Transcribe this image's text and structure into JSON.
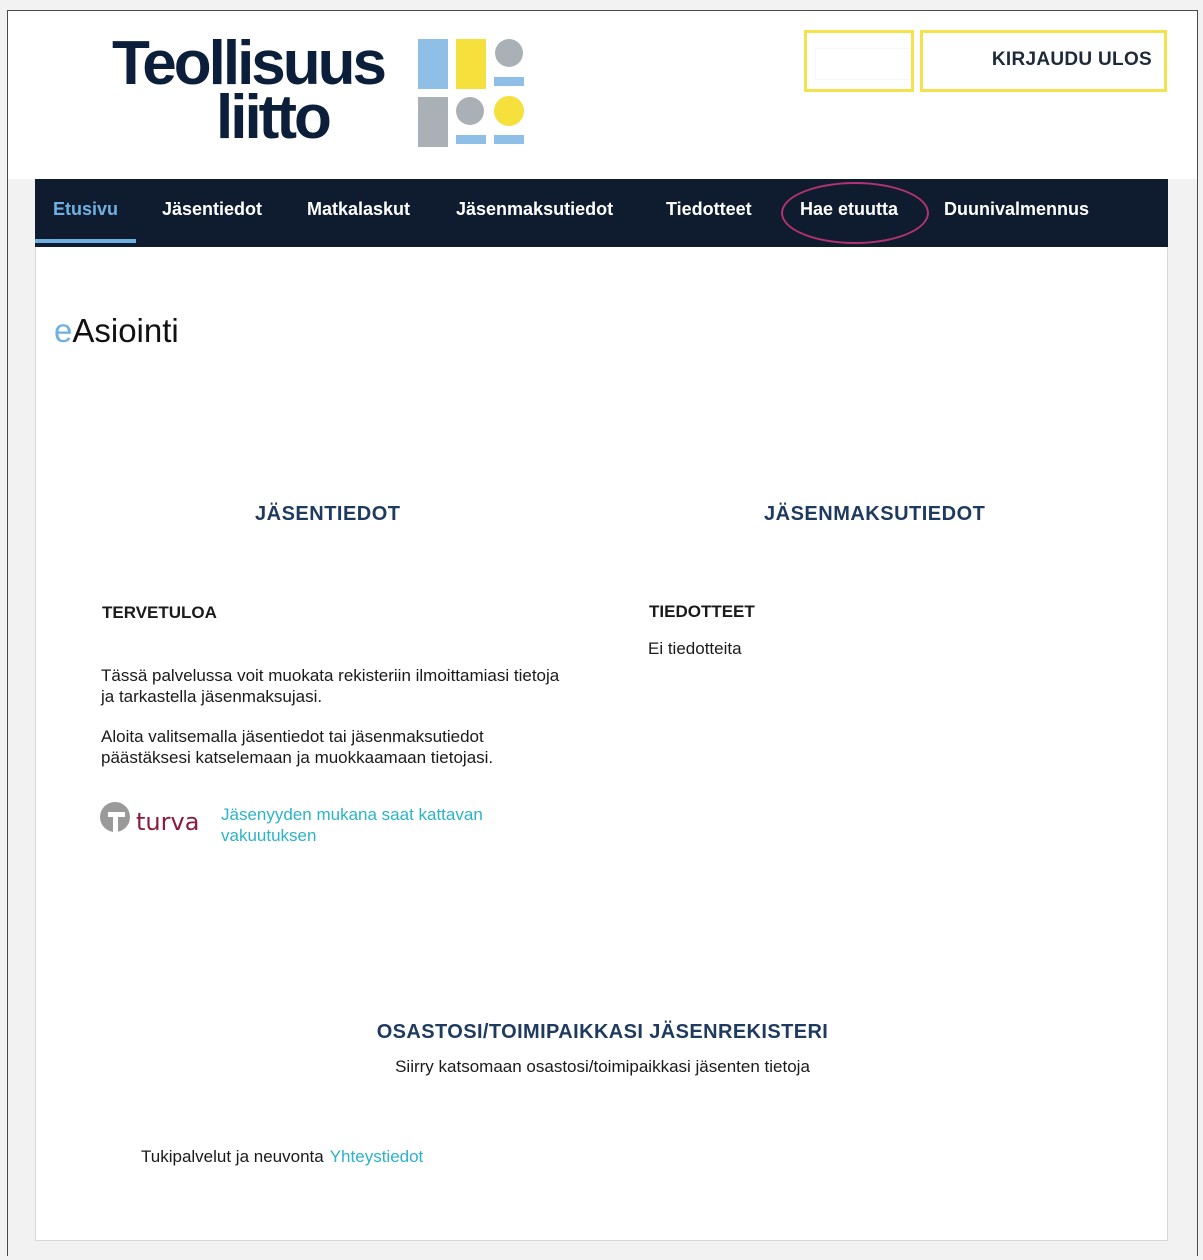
{
  "header": {
    "logo_line1": "Teollisuus",
    "logo_line2": "liitto",
    "empty_button_label": "",
    "logout_label": "KIRJAUDU ULOS"
  },
  "nav": {
    "items": [
      "Etusivu",
      "Jäsentiedot",
      "Matkalaskut",
      "Jäsenmaksutiedot",
      "Tiedotteet",
      "Hae etuutta",
      "Duunivalmennus"
    ],
    "active_index": 0,
    "highlighted_index": 5
  },
  "page": {
    "title_prefix": "e",
    "title_rest": "Asiointi"
  },
  "left": {
    "heading": "JÄSENTIEDOT",
    "welcome": "TERVETULOA",
    "para1": "Tässä palvelussa voit muokata rekisteriin ilmoittamiasi tietoja ja tarkastella jäsenmaksujasi.",
    "para2": "Aloita valitsemalla jäsentiedot tai jäsenmaksutiedot päästäksesi katselemaan ja muokkaamaan tietojasi.",
    "turva_logo_text": "turva",
    "turva_link": "Jäsenyyden mukana saat kattavan vakuutuksen"
  },
  "right": {
    "heading": "JÄSENMAKSUTIEDOT",
    "news_heading": "TIEDOTTEET",
    "news_empty": "Ei tiedotteita"
  },
  "bottom": {
    "heading": "OSASTOSI/TOIMIPAIKKASI JÄSENREKISTERI",
    "subtext": "Siirry katsomaan osastosi/toimipaikkasi jäsenten tietoja"
  },
  "footer": {
    "label": "Tukipalvelut ja neuvonta",
    "link": "Yhteystiedot"
  },
  "colors": {
    "nav_bg": "#0f1c30",
    "accent_blue": "#6fb0e0",
    "link_teal": "#2bb3c8",
    "heading_navy": "#1e3a5f",
    "button_border_yellow": "#f3e24b",
    "highlight_circle": "#b2336e",
    "turva_red": "#8a1c3a"
  }
}
